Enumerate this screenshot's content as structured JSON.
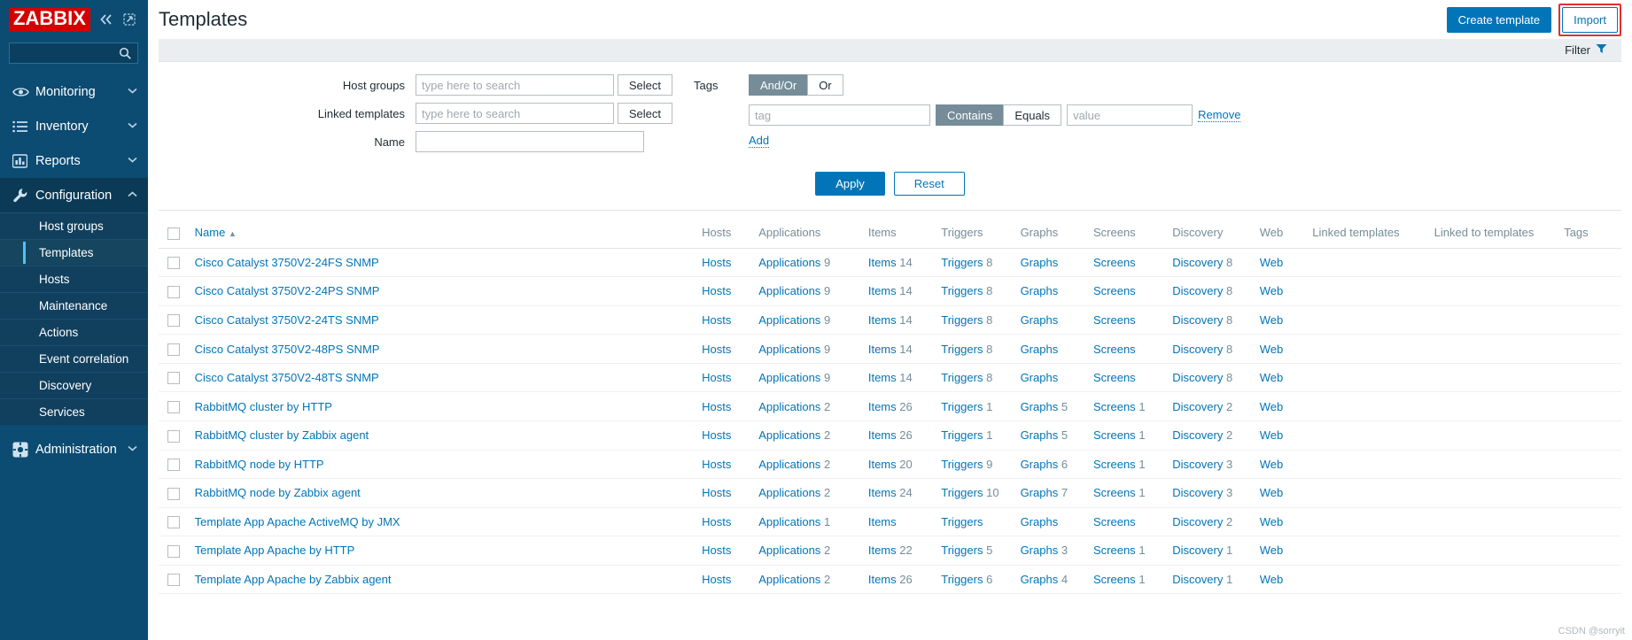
{
  "sidebar": {
    "logo": "ZABBIX",
    "collapse_icon": "chevron-double-left-icon",
    "expand_icon": "expand-icon",
    "search_placeholder": "",
    "search_icon": "search-icon",
    "items": [
      {
        "label": "Monitoring",
        "icon": "eye-icon",
        "chevron": "chevron-down-icon"
      },
      {
        "label": "Inventory",
        "icon": "list-icon",
        "chevron": "chevron-down-icon"
      },
      {
        "label": "Reports",
        "icon": "bar-chart-icon",
        "chevron": "chevron-down-icon"
      },
      {
        "label": "Configuration",
        "icon": "wrench-icon",
        "chevron": "chevron-up-icon"
      },
      {
        "label": "Administration",
        "icon": "gear-icon",
        "chevron": "chevron-down-icon"
      }
    ],
    "config_subitems": [
      {
        "label": "Host groups"
      },
      {
        "label": "Templates"
      },
      {
        "label": "Hosts"
      },
      {
        "label": "Maintenance"
      },
      {
        "label": "Actions"
      },
      {
        "label": "Event correlation"
      },
      {
        "label": "Discovery"
      },
      {
        "label": "Services"
      }
    ]
  },
  "header": {
    "title": "Templates",
    "create_template_label": "Create template",
    "import_label": "Import",
    "import_highlight_color": "#e03131"
  },
  "filter_bar": {
    "label": "Filter",
    "icon": "filter-icon"
  },
  "filter": {
    "host_groups": {
      "label": "Host groups",
      "value": "",
      "placeholder": "type here to search",
      "select_label": "Select"
    },
    "linked_templates": {
      "label": "Linked templates",
      "value": "",
      "placeholder": "type here to search",
      "select_label": "Select"
    },
    "name": {
      "label": "Name",
      "value": "",
      "placeholder": ""
    },
    "tags": {
      "label": "Tags",
      "operator_options": [
        "And/Or",
        "Or"
      ],
      "operator_selected": "And/Or",
      "tag_placeholder": "tag",
      "tag_value": "",
      "match_options": [
        "Contains",
        "Equals"
      ],
      "match_selected": "Contains",
      "value_placeholder": "value",
      "value_value": "",
      "remove_label": "Remove",
      "add_label": "Add"
    },
    "apply_label": "Apply",
    "reset_label": "Reset"
  },
  "table": {
    "columns": [
      "Name",
      "Hosts",
      "Applications",
      "Items",
      "Triggers",
      "Graphs",
      "Screens",
      "Discovery",
      "Web",
      "Linked templates",
      "Linked to templates",
      "Tags"
    ],
    "sort_column": "Name",
    "sort_direction": "asc",
    "sort_glyph": "▲",
    "rows": [
      {
        "name": "Cisco Catalyst 3750V2-24FS SNMP",
        "hosts": "Hosts",
        "applications": "Applications",
        "applications_count": "9",
        "items": "Items",
        "items_count": "14",
        "triggers": "Triggers",
        "triggers_count": "8",
        "graphs": "Graphs",
        "graphs_count": "",
        "screens": "Screens",
        "screens_count": "",
        "discovery": "Discovery",
        "discovery_count": "8",
        "web": "Web",
        "linked_templates": "",
        "linked_to_templates": "",
        "tags": ""
      },
      {
        "name": "Cisco Catalyst 3750V2-24PS SNMP",
        "hosts": "Hosts",
        "applications": "Applications",
        "applications_count": "9",
        "items": "Items",
        "items_count": "14",
        "triggers": "Triggers",
        "triggers_count": "8",
        "graphs": "Graphs",
        "graphs_count": "",
        "screens": "Screens",
        "screens_count": "",
        "discovery": "Discovery",
        "discovery_count": "8",
        "web": "Web",
        "linked_templates": "",
        "linked_to_templates": "",
        "tags": ""
      },
      {
        "name": "Cisco Catalyst 3750V2-24TS SNMP",
        "hosts": "Hosts",
        "applications": "Applications",
        "applications_count": "9",
        "items": "Items",
        "items_count": "14",
        "triggers": "Triggers",
        "triggers_count": "8",
        "graphs": "Graphs",
        "graphs_count": "",
        "screens": "Screens",
        "screens_count": "",
        "discovery": "Discovery",
        "discovery_count": "8",
        "web": "Web",
        "linked_templates": "",
        "linked_to_templates": "",
        "tags": ""
      },
      {
        "name": "Cisco Catalyst 3750V2-48PS SNMP",
        "hosts": "Hosts",
        "applications": "Applications",
        "applications_count": "9",
        "items": "Items",
        "items_count": "14",
        "triggers": "Triggers",
        "triggers_count": "8",
        "graphs": "Graphs",
        "graphs_count": "",
        "screens": "Screens",
        "screens_count": "",
        "discovery": "Discovery",
        "discovery_count": "8",
        "web": "Web",
        "linked_templates": "",
        "linked_to_templates": "",
        "tags": ""
      },
      {
        "name": "Cisco Catalyst 3750V2-48TS SNMP",
        "hosts": "Hosts",
        "applications": "Applications",
        "applications_count": "9",
        "items": "Items",
        "items_count": "14",
        "triggers": "Triggers",
        "triggers_count": "8",
        "graphs": "Graphs",
        "graphs_count": "",
        "screens": "Screens",
        "screens_count": "",
        "discovery": "Discovery",
        "discovery_count": "8",
        "web": "Web",
        "linked_templates": "",
        "linked_to_templates": "",
        "tags": ""
      },
      {
        "name": "RabbitMQ cluster by HTTP",
        "hosts": "Hosts",
        "applications": "Applications",
        "applications_count": "2",
        "items": "Items",
        "items_count": "26",
        "triggers": "Triggers",
        "triggers_count": "1",
        "graphs": "Graphs",
        "graphs_count": "5",
        "screens": "Screens",
        "screens_count": "1",
        "discovery": "Discovery",
        "discovery_count": "2",
        "web": "Web",
        "linked_templates": "",
        "linked_to_templates": "",
        "tags": ""
      },
      {
        "name": "RabbitMQ cluster by Zabbix agent",
        "hosts": "Hosts",
        "applications": "Applications",
        "applications_count": "2",
        "items": "Items",
        "items_count": "26",
        "triggers": "Triggers",
        "triggers_count": "1",
        "graphs": "Graphs",
        "graphs_count": "5",
        "screens": "Screens",
        "screens_count": "1",
        "discovery": "Discovery",
        "discovery_count": "2",
        "web": "Web",
        "linked_templates": "",
        "linked_to_templates": "",
        "tags": ""
      },
      {
        "name": "RabbitMQ node by HTTP",
        "hosts": "Hosts",
        "applications": "Applications",
        "applications_count": "2",
        "items": "Items",
        "items_count": "20",
        "triggers": "Triggers",
        "triggers_count": "9",
        "graphs": "Graphs",
        "graphs_count": "6",
        "screens": "Screens",
        "screens_count": "1",
        "discovery": "Discovery",
        "discovery_count": "3",
        "web": "Web",
        "linked_templates": "",
        "linked_to_templates": "",
        "tags": ""
      },
      {
        "name": "RabbitMQ node by Zabbix agent",
        "hosts": "Hosts",
        "applications": "Applications",
        "applications_count": "2",
        "items": "Items",
        "items_count": "24",
        "triggers": "Triggers",
        "triggers_count": "10",
        "graphs": "Graphs",
        "graphs_count": "7",
        "screens": "Screens",
        "screens_count": "1",
        "discovery": "Discovery",
        "discovery_count": "3",
        "web": "Web",
        "linked_templates": "",
        "linked_to_templates": "",
        "tags": ""
      },
      {
        "name": "Template App Apache ActiveMQ by JMX",
        "hosts": "Hosts",
        "applications": "Applications",
        "applications_count": "1",
        "items": "Items",
        "items_count": "",
        "triggers": "Triggers",
        "triggers_count": "",
        "graphs": "Graphs",
        "graphs_count": "",
        "screens": "Screens",
        "screens_count": "",
        "discovery": "Discovery",
        "discovery_count": "2",
        "web": "Web",
        "linked_templates": "",
        "linked_to_templates": "",
        "tags": ""
      },
      {
        "name": "Template App Apache by HTTP",
        "hosts": "Hosts",
        "applications": "Applications",
        "applications_count": "2",
        "items": "Items",
        "items_count": "22",
        "triggers": "Triggers",
        "triggers_count": "5",
        "graphs": "Graphs",
        "graphs_count": "3",
        "screens": "Screens",
        "screens_count": "1",
        "discovery": "Discovery",
        "discovery_count": "1",
        "web": "Web",
        "linked_templates": "",
        "linked_to_templates": "",
        "tags": ""
      },
      {
        "name": "Template App Apache by Zabbix agent",
        "hosts": "Hosts",
        "applications": "Applications",
        "applications_count": "2",
        "items": "Items",
        "items_count": "26",
        "triggers": "Triggers",
        "triggers_count": "6",
        "graphs": "Graphs",
        "graphs_count": "4",
        "screens": "Screens",
        "screens_count": "1",
        "discovery": "Discovery",
        "discovery_count": "1",
        "web": "Web",
        "linked_templates": "",
        "linked_to_templates": "",
        "tags": ""
      }
    ]
  },
  "watermark": "CSDN @sorryit"
}
